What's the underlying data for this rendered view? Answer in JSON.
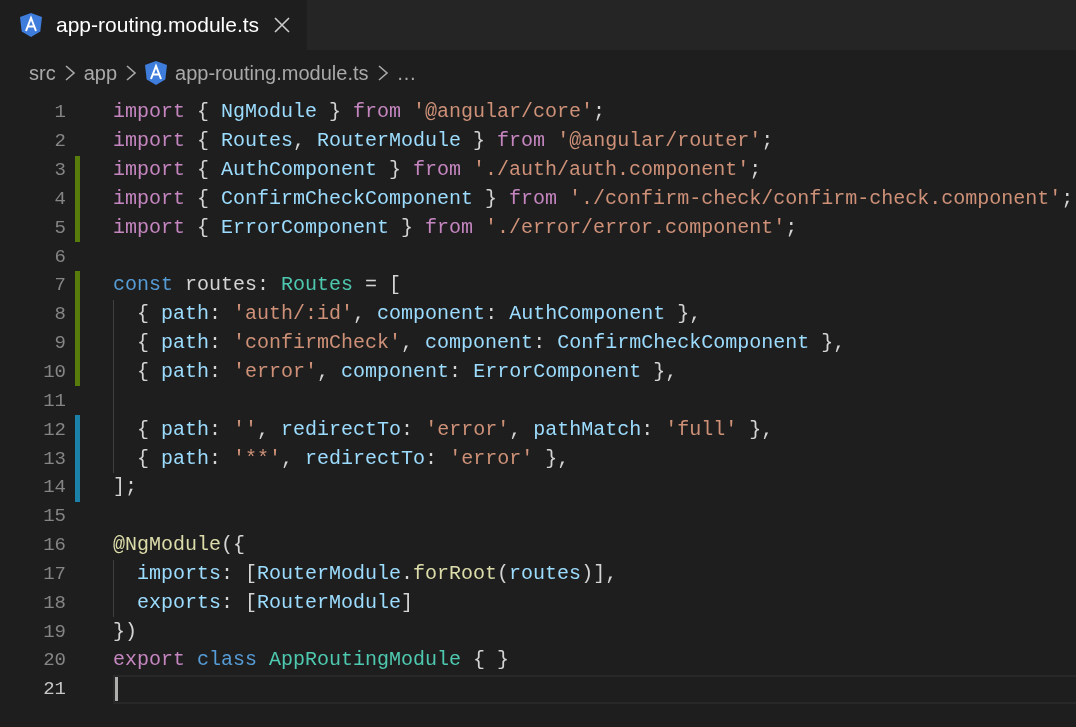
{
  "tabs": [
    {
      "label": "app-routing.module.ts",
      "selected": true
    }
  ],
  "breadcrumbs": [
    {
      "kind": "folder",
      "text": "src"
    },
    {
      "kind": "folder",
      "text": "app"
    },
    {
      "kind": "file",
      "text": "app-routing.module.ts"
    },
    {
      "kind": "more",
      "text": "…"
    }
  ],
  "lines": [
    {
      "number": "1",
      "current": false,
      "tokens": [
        {
          "kind": "keyword",
          "text": "import"
        },
        {
          "kind": "punct",
          "text": " { "
        },
        {
          "kind": "variable",
          "text": "NgModule"
        },
        {
          "kind": "punct",
          "text": " } "
        },
        {
          "kind": "keyword",
          "text": "from "
        },
        {
          "kind": "string",
          "text": "'@angular/core'"
        },
        {
          "kind": "punct",
          "text": ";"
        }
      ]
    },
    {
      "number": "2",
      "current": false,
      "tokens": [
        {
          "kind": "keyword",
          "text": "import"
        },
        {
          "kind": "punct",
          "text": " { "
        },
        {
          "kind": "variable",
          "text": "Routes"
        },
        {
          "kind": "punct",
          "text": ", "
        },
        {
          "kind": "variable",
          "text": "RouterModule"
        },
        {
          "kind": "punct",
          "text": " } "
        },
        {
          "kind": "keyword",
          "text": "from "
        },
        {
          "kind": "string",
          "text": "'@angular/router'"
        },
        {
          "kind": "punct",
          "text": ";"
        }
      ]
    },
    {
      "number": "3",
      "color": "#587c0c",
      "current": false,
      "tokens": [
        {
          "kind": "keyword",
          "text": "import"
        },
        {
          "kind": "punct",
          "text": " { "
        },
        {
          "kind": "variable",
          "text": "AuthComponent"
        },
        {
          "kind": "punct",
          "text": " } "
        },
        {
          "kind": "keyword",
          "text": "from "
        },
        {
          "kind": "string",
          "text": "'./auth/auth.component'"
        },
        {
          "kind": "punct",
          "text": ";"
        }
      ]
    },
    {
      "number": "4",
      "color": "#587c0c",
      "current": false,
      "tokens": [
        {
          "kind": "keyword",
          "text": "import"
        },
        {
          "kind": "punct",
          "text": " { "
        },
        {
          "kind": "variable",
          "text": "ConfirmCheckComponent"
        },
        {
          "kind": "punct",
          "text": " } "
        },
        {
          "kind": "keyword",
          "text": "from "
        },
        {
          "kind": "string",
          "text": "'./confirm-check/confirm-check.component'"
        },
        {
          "kind": "punct",
          "text": ";"
        }
      ]
    },
    {
      "number": "5",
      "color": "#587c0c",
      "current": false,
      "tokens": [
        {
          "kind": "keyword",
          "text": "import"
        },
        {
          "kind": "punct",
          "text": " { "
        },
        {
          "kind": "variable",
          "text": "ErrorComponent"
        },
        {
          "kind": "punct",
          "text": " } "
        },
        {
          "kind": "keyword",
          "text": "from "
        },
        {
          "kind": "string",
          "text": "'./error/error.component'"
        },
        {
          "kind": "punct",
          "text": ";"
        }
      ]
    },
    {
      "number": "6",
      "current": false
    },
    {
      "number": "7",
      "color": "#587c0c",
      "current": false,
      "tokens": [
        {
          "kind": "storage",
          "text": "const"
        },
        {
          "kind": "punct",
          "text": " routes: "
        },
        {
          "kind": "type",
          "text": "Routes"
        },
        {
          "kind": "punct",
          "text": " = ["
        }
      ]
    },
    {
      "number": "8",
      "color": "#587c0c",
      "current": false,
      "indented": true,
      "tokens": [
        {
          "kind": "punct",
          "text": "{ "
        },
        {
          "kind": "variable",
          "text": "path"
        },
        {
          "kind": "punct",
          "text": ": "
        },
        {
          "kind": "string",
          "text": "'auth/:id'"
        },
        {
          "kind": "punct",
          "text": ", "
        },
        {
          "kind": "variable",
          "text": "component"
        },
        {
          "kind": "punct",
          "text": ": "
        },
        {
          "kind": "variable",
          "text": "AuthComponent"
        },
        {
          "kind": "punct",
          "text": " },"
        }
      ]
    },
    {
      "number": "9",
      "color": "#587c0c",
      "current": false,
      "indented": true,
      "tokens": [
        {
          "kind": "punct",
          "text": "{ "
        },
        {
          "kind": "variable",
          "text": "path"
        },
        {
          "kind": "punct",
          "text": ": "
        },
        {
          "kind": "string",
          "text": "'confirmCheck'"
        },
        {
          "kind": "punct",
          "text": ", "
        },
        {
          "kind": "variable",
          "text": "component"
        },
        {
          "kind": "punct",
          "text": ": "
        },
        {
          "kind": "variable",
          "text": "ConfirmCheckComponent"
        },
        {
          "kind": "punct",
          "text": " },"
        }
      ]
    },
    {
      "number": "10",
      "color": "#587c0c",
      "current": false,
      "indented": true,
      "tokens": [
        {
          "kind": "punct",
          "text": "{ "
        },
        {
          "kind": "variable",
          "text": "path"
        },
        {
          "kind": "punct",
          "text": ": "
        },
        {
          "kind": "string",
          "text": "'error'"
        },
        {
          "kind": "punct",
          "text": ", "
        },
        {
          "kind": "variable",
          "text": "component"
        },
        {
          "kind": "punct",
          "text": ": "
        },
        {
          "kind": "variable",
          "text": "ErrorComponent"
        },
        {
          "kind": "punct",
          "text": " },"
        }
      ]
    },
    {
      "number": "11",
      "current": false,
      "indented": true
    },
    {
      "number": "12",
      "color": "#1b81a8",
      "current": false,
      "indented": true,
      "tokens": [
        {
          "kind": "punct",
          "text": "{ "
        },
        {
          "kind": "variable",
          "text": "path"
        },
        {
          "kind": "punct",
          "text": ": "
        },
        {
          "kind": "string",
          "text": "''"
        },
        {
          "kind": "punct",
          "text": ", "
        },
        {
          "kind": "variable",
          "text": "redirectTo"
        },
        {
          "kind": "punct",
          "text": ": "
        },
        {
          "kind": "string",
          "text": "'error'"
        },
        {
          "kind": "punct",
          "text": ", "
        },
        {
          "kind": "variable",
          "text": "pathMatch"
        },
        {
          "kind": "punct",
          "text": ": "
        },
        {
          "kind": "string",
          "text": "'full'"
        },
        {
          "kind": "punct",
          "text": " },"
        }
      ]
    },
    {
      "number": "13",
      "color": "#1b81a8",
      "current": false,
      "indented": true,
      "tokens": [
        {
          "kind": "punct",
          "text": "{ "
        },
        {
          "kind": "variable",
          "text": "path"
        },
        {
          "kind": "punct",
          "text": ": "
        },
        {
          "kind": "string",
          "text": "'**'"
        },
        {
          "kind": "punct",
          "text": ", "
        },
        {
          "kind": "variable",
          "text": "redirectTo"
        },
        {
          "kind": "punct",
          "text": ": "
        },
        {
          "kind": "string",
          "text": "'error'"
        },
        {
          "kind": "punct",
          "text": " },"
        }
      ]
    },
    {
      "number": "14",
      "color": "#1b81a8",
      "current": false,
      "tokens": [
        {
          "kind": "punct",
          "text": "];"
        }
      ]
    },
    {
      "number": "15",
      "current": false
    },
    {
      "number": "16",
      "current": false,
      "tokens": [
        {
          "kind": "function",
          "text": "@NgModule"
        },
        {
          "kind": "punct",
          "text": "({"
        }
      ]
    },
    {
      "number": "17",
      "current": false,
      "indented": true,
      "tokens": [
        {
          "kind": "variable",
          "text": "imports"
        },
        {
          "kind": "punct",
          "text": ": ["
        },
        {
          "kind": "variable",
          "text": "RouterModule"
        },
        {
          "kind": "punct",
          "text": "."
        },
        {
          "kind": "function",
          "text": "forRoot"
        },
        {
          "kind": "punct",
          "text": "("
        },
        {
          "kind": "variable",
          "text": "routes"
        },
        {
          "kind": "punct",
          "text": ")],"
        }
      ]
    },
    {
      "number": "18",
      "current": false,
      "indented": true,
      "tokens": [
        {
          "kind": "variable",
          "text": "exports"
        },
        {
          "kind": "punct",
          "text": ": ["
        },
        {
          "kind": "variable",
          "text": "RouterModule"
        },
        {
          "kind": "punct",
          "text": "]"
        }
      ]
    },
    {
      "number": "19",
      "current": false,
      "tokens": [
        {
          "kind": "punct",
          "text": "})"
        }
      ]
    },
    {
      "number": "20",
      "current": false,
      "tokens": [
        {
          "kind": "keyword",
          "text": "export "
        },
        {
          "kind": "storage",
          "text": "class "
        },
        {
          "kind": "type",
          "text": "AppRoutingModule"
        },
        {
          "kind": "punct",
          "text": " { }"
        }
      ]
    },
    {
      "number": "21",
      "current": true
    }
  ]
}
